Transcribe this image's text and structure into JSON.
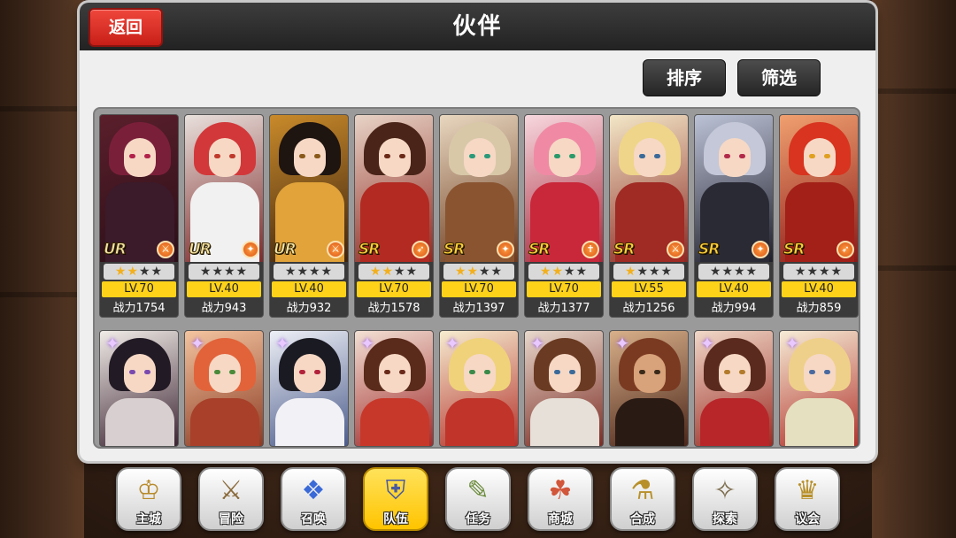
{
  "header": {
    "title": "伙伴",
    "back_label": "返回",
    "sort_label": "排序",
    "filter_label": "筛选"
  },
  "partners_row1": [
    {
      "rarity": "UR",
      "stars": "★★★★",
      "level": "LV.70",
      "power": "战力1754",
      "class_icon": "⚔"
    },
    {
      "rarity": "UR",
      "stars": "★★★★",
      "level": "LV.40",
      "power": "战力943",
      "class_icon": "✦"
    },
    {
      "rarity": "UR",
      "stars": "★★★★",
      "level": "LV.40",
      "power": "战力932",
      "class_icon": "⚔"
    },
    {
      "rarity": "SR",
      "stars": "★★★★",
      "level": "LV.70",
      "power": "战力1578",
      "class_icon": "➶"
    },
    {
      "rarity": "SR",
      "stars": "★★★★",
      "level": "LV.70",
      "power": "战力1397",
      "class_icon": "✦"
    },
    {
      "rarity": "SR",
      "stars": "★★★★",
      "level": "LV.70",
      "power": "战力1377",
      "class_icon": "✝"
    },
    {
      "rarity": "SR",
      "stars": "★★★★",
      "level": "LV.55",
      "power": "战力1256",
      "class_icon": "⚔"
    },
    {
      "rarity": "SR",
      "stars": "★★★★",
      "level": "LV.40",
      "power": "战力994",
      "class_icon": "✦"
    },
    {
      "rarity": "SR",
      "stars": "★★★★",
      "level": "LV.40",
      "power": "战力859",
      "class_icon": "➶"
    }
  ],
  "bottom_nav": [
    {
      "label": "主城",
      "icon": "♔"
    },
    {
      "label": "冒险",
      "icon": "⚔"
    },
    {
      "label": "召唤",
      "icon": "❖"
    },
    {
      "label": "队伍",
      "icon": "⛨"
    },
    {
      "label": "任务",
      "icon": "✎"
    },
    {
      "label": "商城",
      "icon": "☘"
    },
    {
      "label": "合成",
      "icon": "⚗"
    },
    {
      "label": "探索",
      "icon": "✧"
    },
    {
      "label": "议会",
      "icon": "♛"
    }
  ],
  "colors": {
    "accent_red": "#d8281f",
    "level_yellow": "#ffd21a",
    "nav_active": "#ffcf1a",
    "rarity_ur": "#f4e3a6",
    "rarity_sr": "#ffd23c"
  }
}
